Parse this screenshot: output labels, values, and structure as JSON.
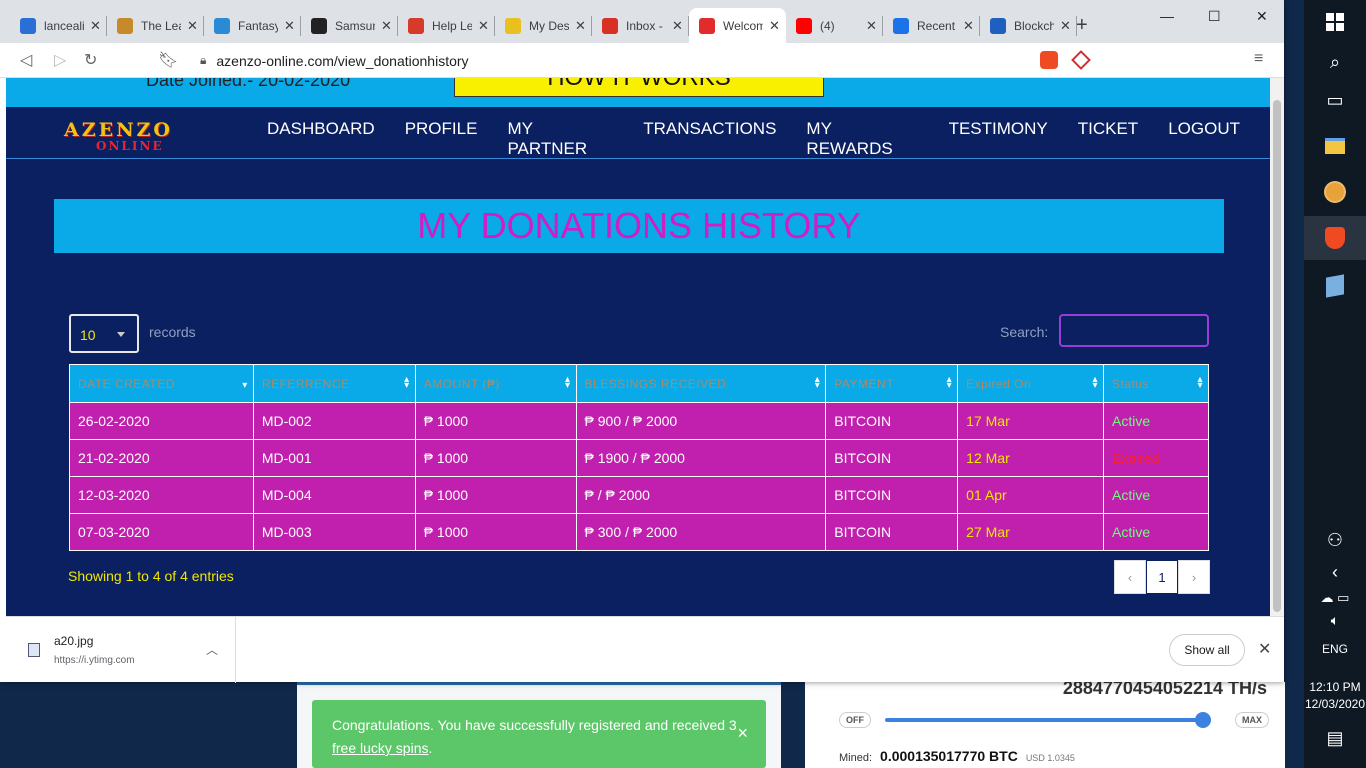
{
  "browser": {
    "tabs": [
      {
        "label": "lancealin",
        "color": "#2a6fd6"
      },
      {
        "label": "The Lea",
        "color": "#c78a2b"
      },
      {
        "label": "Fantasy",
        "color": "#2a8ad6"
      },
      {
        "label": "Samsun",
        "color": "#222222"
      },
      {
        "label": "Help Le",
        "color": "#d63a2a"
      },
      {
        "label": "My Des",
        "color": "#e8c020"
      },
      {
        "label": "Inbox -",
        "color": "#d93025"
      },
      {
        "label": "Welcom",
        "color": "#e22b2b"
      },
      {
        "label": "(4)",
        "color": "#ff0000"
      },
      {
        "label": "Recent",
        "color": "#1a73e8"
      },
      {
        "label": "Blockch",
        "color": "#1f5fbf"
      }
    ],
    "url": "azenzo-online.com/view_donationhistory"
  },
  "page": {
    "date_joined": "Date Joined:- 20-02-2020",
    "how_it_works": "HOW IT WORKS",
    "logo_main": "AZENZO",
    "logo_sub": "ONLINE",
    "nav": [
      "DASHBOARD",
      "PROFILE",
      "MY PARTNER",
      "TRANSACTIONS",
      "MY REWARDS",
      "TESTIMONY",
      "TICKET",
      "LOGOUT"
    ],
    "title": "MY DONATIONS HISTORY",
    "length_value": "10",
    "length_label": "records",
    "search_label": "Search:",
    "columns": [
      "DATE CREATED",
      "REFERRENCE",
      "AMOUNT (₱)",
      "BLESSINGS RECEIVED",
      "PAYMENT",
      "Expired On",
      "Status"
    ],
    "rows": [
      [
        "26-02-2020",
        "MD-002",
        "₱ 1000",
        "₱ 900 / ₱ 2000",
        "BITCOIN",
        "17 Mar",
        "Active"
      ],
      [
        "21-02-2020",
        "MD-001",
        "₱ 1000",
        "₱ 1900 / ₱ 2000",
        "BITCOIN",
        "12 Mar",
        "Expired"
      ],
      [
        "12-03-2020",
        "MD-004",
        "₱ 1000",
        "₱ / ₱ 2000",
        "BITCOIN",
        "01 Apr",
        "Active"
      ],
      [
        "07-03-2020",
        "MD-003",
        "₱ 1000",
        "₱ 300 / ₱ 2000",
        "BITCOIN",
        "27 Mar",
        "Active"
      ]
    ],
    "info": "Showing 1 to 4 of 4 entries",
    "pager": {
      "prev": "‹",
      "current": "1",
      "next": "›"
    }
  },
  "downloads": {
    "file": "a20.jpg",
    "source": "https://i.ytimg.com",
    "show_all": "Show all"
  },
  "background": {
    "toast_text": "Congratulations. You have successfully registered and received 3",
    "toast_link": "free lucky spins",
    "toast_after": ".",
    "slider_off": "OFF",
    "slider_max": "MAX",
    "mined_label": "Mined:",
    "mined_value": "0.000135017770 BTC",
    "mined_usd": "USD 1.0345",
    "top_text": "2884770454052214 TH/s"
  },
  "taskbar": {
    "lang": "ENG",
    "time": "12:10 PM",
    "date": "12/03/2020"
  }
}
